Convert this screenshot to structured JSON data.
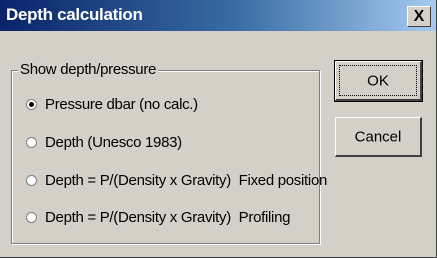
{
  "window": {
    "title": "Depth calculation",
    "close_label": "X"
  },
  "group": {
    "label": "Show depth/pressure",
    "options": [
      {
        "label": "Pressure dbar (no calc.)",
        "checked": true
      },
      {
        "label": "Depth (Unesco 1983)",
        "checked": false
      },
      {
        "label": "Depth = P/(Density x Gravity)  Fixed position",
        "checked": false
      },
      {
        "label": "Depth = P/(Density x Gravity)  Profiling",
        "checked": false
      }
    ]
  },
  "buttons": {
    "ok_label": "OK",
    "cancel_label": "Cancel"
  }
}
